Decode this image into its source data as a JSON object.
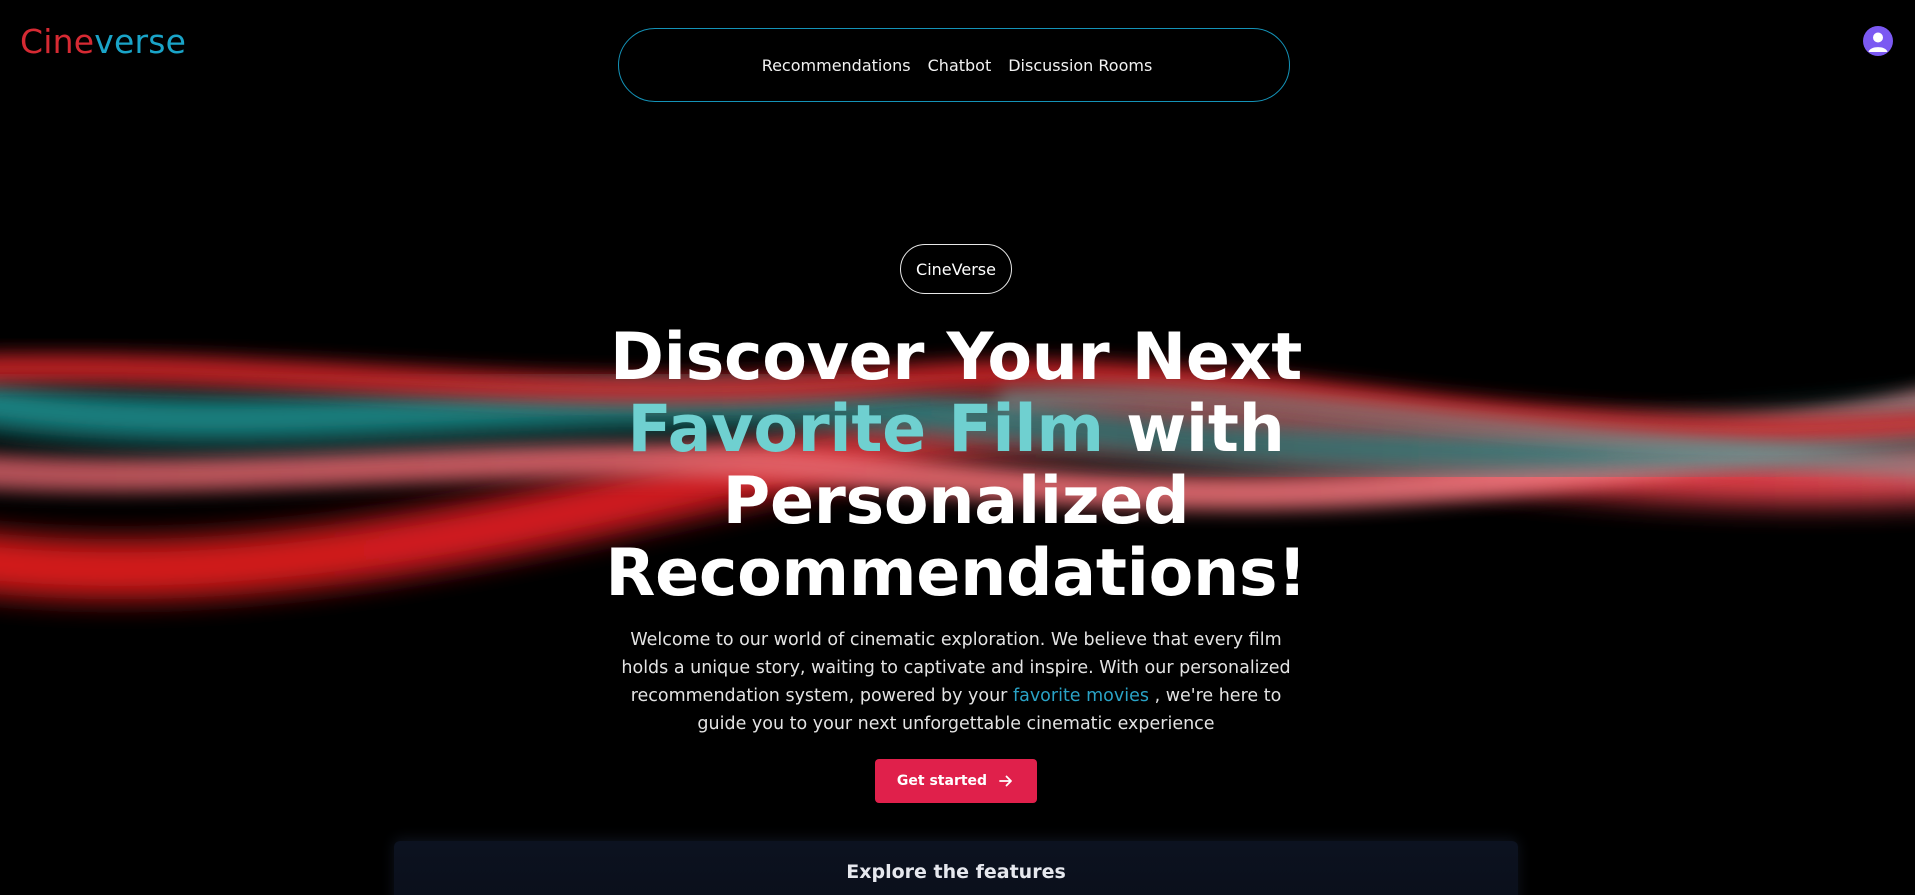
{
  "brand": {
    "part1": "Cine",
    "part2": "verse",
    "color1": "#d62a33",
    "color2": "#1aa4c8"
  },
  "nav": {
    "items": [
      "Recommendations",
      "Chatbot",
      "Discussion Rooms"
    ]
  },
  "user": {
    "icon": "user-avatar-icon",
    "color": "#7b59f2"
  },
  "badge": {
    "label": "CineVerse"
  },
  "hero": {
    "line1": "Discover Your Next",
    "line2_accent": "Favorite Film",
    "line2_rest": " with",
    "line3": "Personalized",
    "line4": "Recommendations!",
    "accent_color": "#6fd0d0"
  },
  "lead": {
    "text_before": "Welcome to our world of cinematic exploration. We believe that every film holds a unique story, waiting to captivate and inspire. With our personalized recommendation system, powered by your ",
    "link": "favorite movies",
    "text_after": " , we're here to guide you to your next unforgettable cinematic experience"
  },
  "cta": {
    "label": "Get started",
    "icon": "arrow-right-icon",
    "color": "#e0204b"
  },
  "features": {
    "title": "Explore the features"
  }
}
